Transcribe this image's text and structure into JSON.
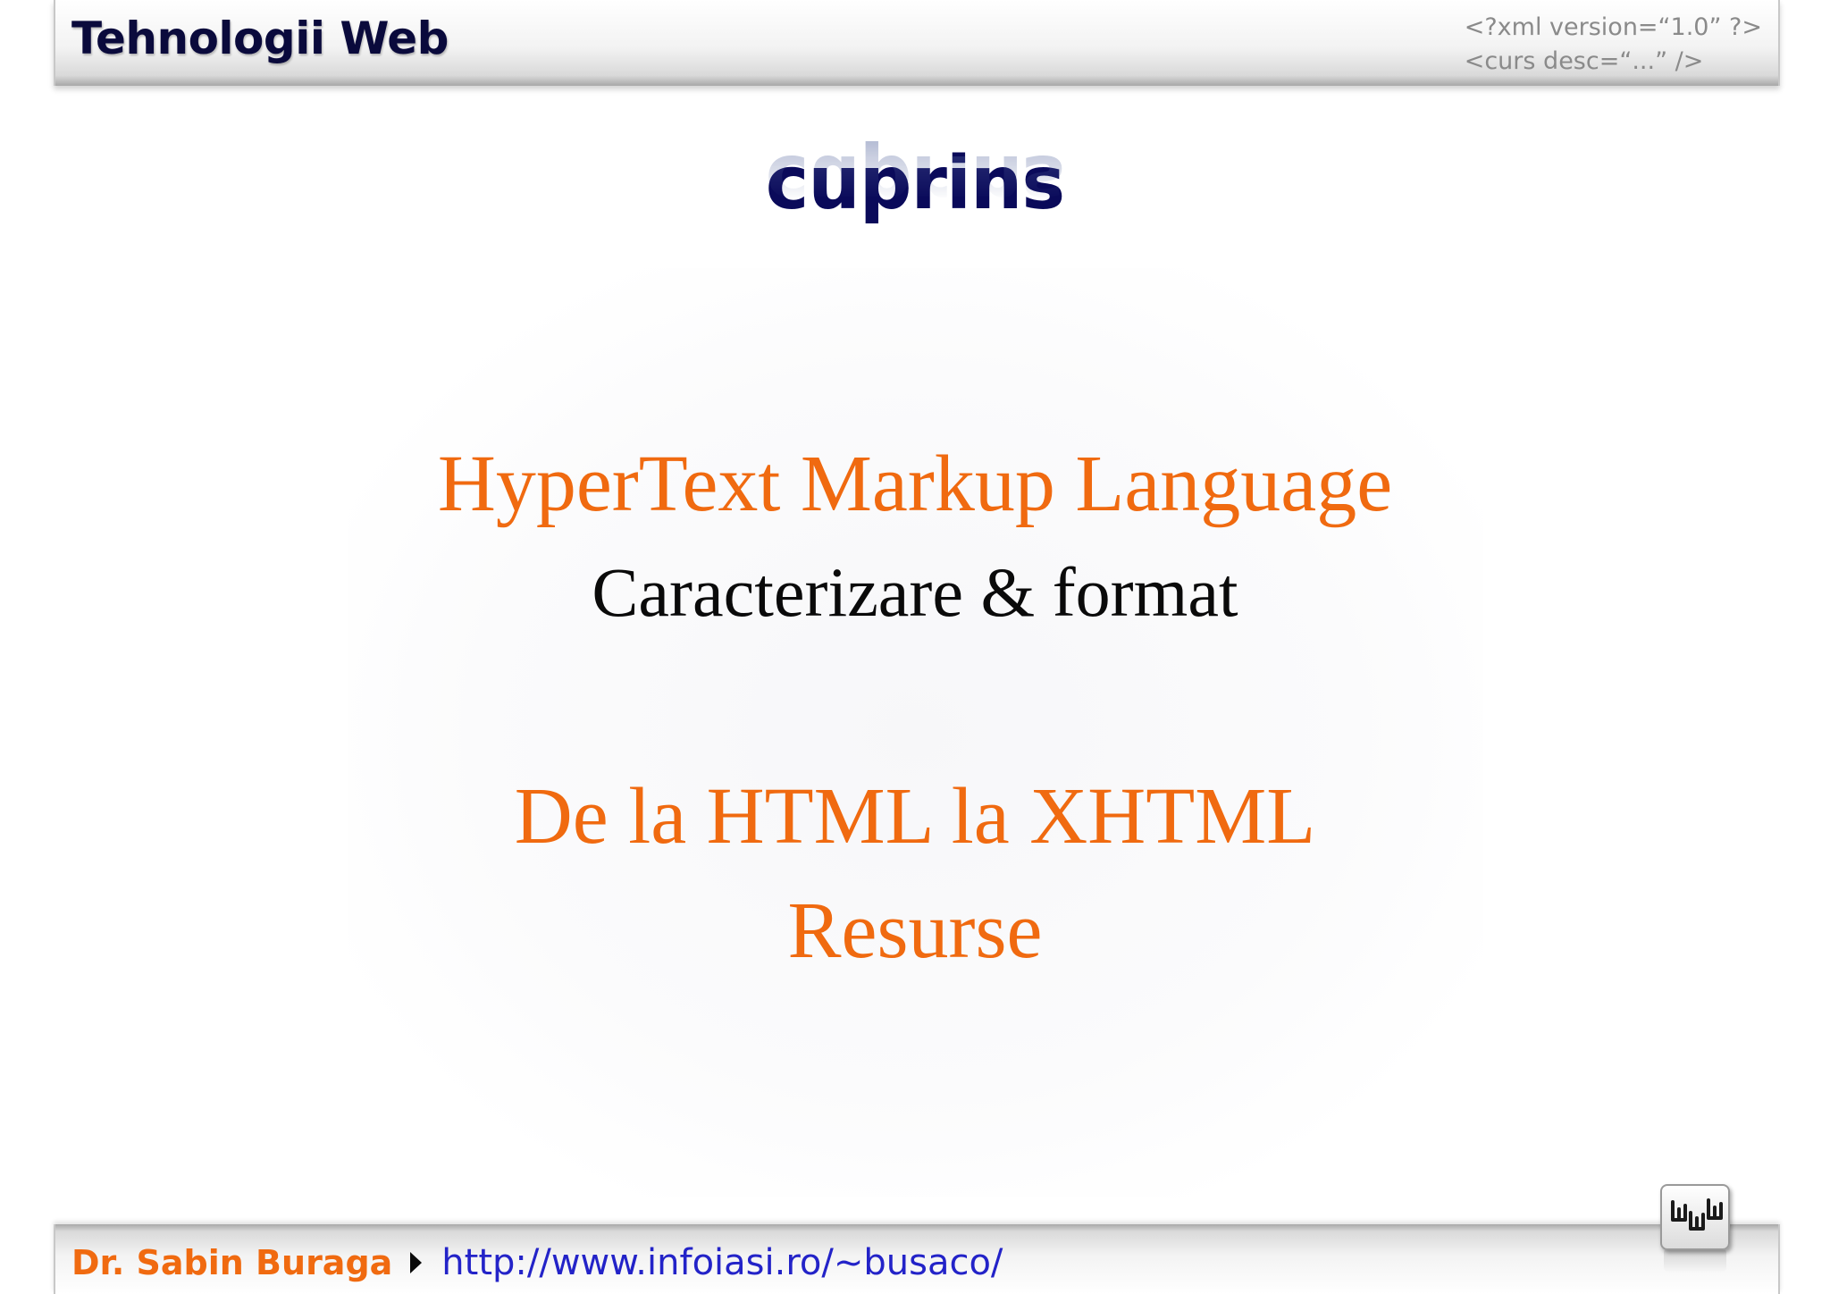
{
  "header": {
    "title": "Tehnologii Web",
    "code_line_1": "<?xml version=“1.0” ?>",
    "code_line_2": "<curs desc=“...” />"
  },
  "slide": {
    "title": "cuprins",
    "items": [
      "HyperText Markup Language",
      "Caracterizare & format",
      "De la HTML la XHTML",
      "Resurse"
    ]
  },
  "footer": {
    "author": "Dr. Sabin Buraga",
    "url": "http://www.infoiasi.ro/~busaco/",
    "logo_icon": "web-logo-icon"
  },
  "colors": {
    "title_navy": "#0a0a5a",
    "accent_orange": "#f06a10",
    "link_blue": "#2323c8"
  }
}
